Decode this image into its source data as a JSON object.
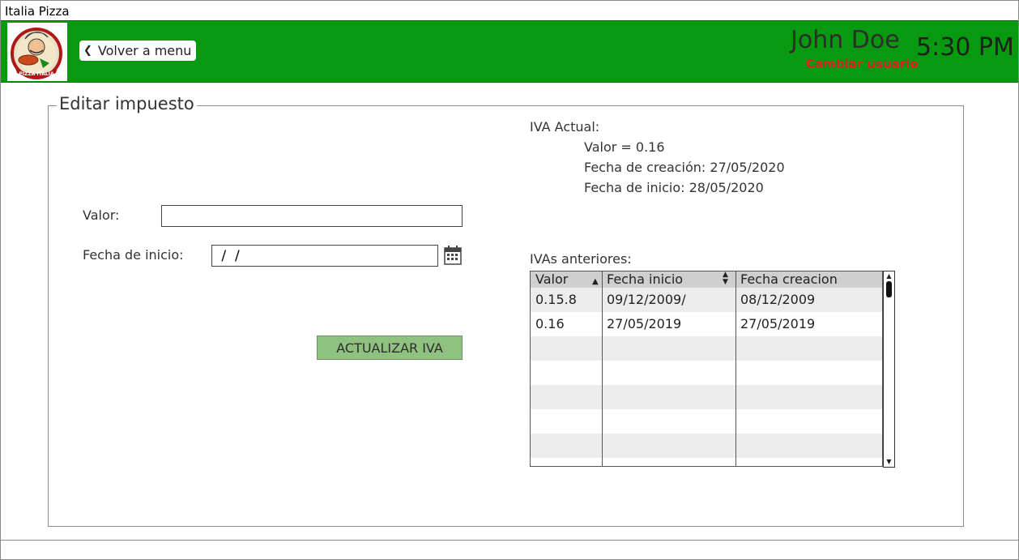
{
  "window": {
    "title": "Italia Pizza"
  },
  "header": {
    "logo_text": "PIZZA ITALIA",
    "back_label": "Volver a menu",
    "user_name": "John Doe",
    "change_user_label": "Cambiar usuario",
    "time": "5:30 PM",
    "bar_color": "#07990f"
  },
  "form": {
    "legend": "Editar impuesto",
    "valor_label": "Valor:",
    "valor_value": "",
    "fecha_label": "Fecha de inicio:",
    "fecha_value": " /  /",
    "update_button": "ACTUALIZAR IVA"
  },
  "current_iva": {
    "title": "IVA Actual:",
    "valor": "Valor = 0.16",
    "fecha_creacion": "Fecha de creación: 27/05/2020",
    "fecha_inicio": "Fecha de inicio: 28/05/2020"
  },
  "history": {
    "title": "IVAs anteriores:",
    "columns": [
      "Valor",
      "Fecha inicio",
      "Fecha creacion"
    ],
    "rows": [
      [
        "0.15.8",
        "09/12/2009/",
        "08/12/2009"
      ],
      [
        "0.16",
        "27/05/2019",
        "27/05/2019"
      ]
    ]
  },
  "icons": {
    "back": "chevron-left-icon",
    "calendar": "calendar-icon",
    "sort_asc": "sort-ascending-icon",
    "sort_both": "sort-icon"
  }
}
